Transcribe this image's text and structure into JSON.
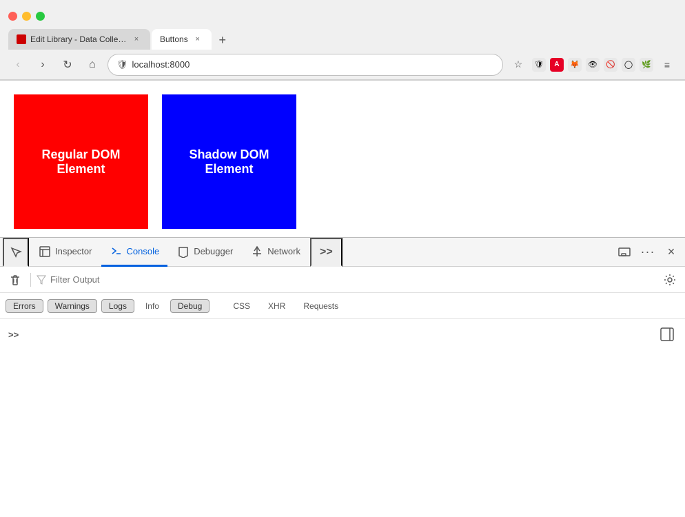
{
  "browser": {
    "tabs": [
      {
        "id": "tab1",
        "label": "Edit Library - Data Collection | T...",
        "active": false,
        "favicon": "A",
        "favicon_color": "#cc0000"
      },
      {
        "id": "tab2",
        "label": "Buttons",
        "active": true,
        "favicon": ""
      }
    ],
    "address": "localhost:8000"
  },
  "page": {
    "boxes": [
      {
        "label": "Regular DOM Element",
        "class": "regular-dom"
      },
      {
        "label": "Shadow DOM Element",
        "class": "shadow-dom"
      }
    ]
  },
  "devtools": {
    "tabs": [
      {
        "id": "pick",
        "label": "",
        "icon": "pick",
        "active": false
      },
      {
        "id": "inspector",
        "label": "Inspector",
        "icon": "inspector",
        "active": false
      },
      {
        "id": "console",
        "label": "Console",
        "icon": "console",
        "active": true
      },
      {
        "id": "debugger",
        "label": "Debugger",
        "icon": "debugger",
        "active": false
      },
      {
        "id": "network",
        "label": "Network",
        "icon": "network",
        "active": false
      }
    ],
    "overflow_label": ">>",
    "responsive_label": "",
    "more_label": "···",
    "close_label": "×"
  },
  "console": {
    "filter_placeholder": "Filter Output",
    "clear_label": "🗑",
    "settings_label": "⚙",
    "log_filters": [
      {
        "id": "errors",
        "label": "Errors",
        "active": true
      },
      {
        "id": "warnings",
        "label": "Warnings",
        "active": true
      },
      {
        "id": "logs",
        "label": "Logs",
        "active": true
      },
      {
        "id": "info",
        "label": "Info",
        "active": false
      },
      {
        "id": "debug",
        "label": "Debug",
        "active": true
      }
    ],
    "extra_filters": [
      {
        "id": "css",
        "label": "CSS"
      },
      {
        "id": "xhr",
        "label": "XHR"
      },
      {
        "id": "requests",
        "label": "Requests"
      }
    ],
    "prompt": ">>",
    "sidebar_icon": "⊟"
  },
  "nav": {
    "back_label": "‹",
    "forward_label": "›",
    "reload_label": "↻",
    "home_label": "⌂",
    "star_label": "☆",
    "menu_label": "≡"
  }
}
